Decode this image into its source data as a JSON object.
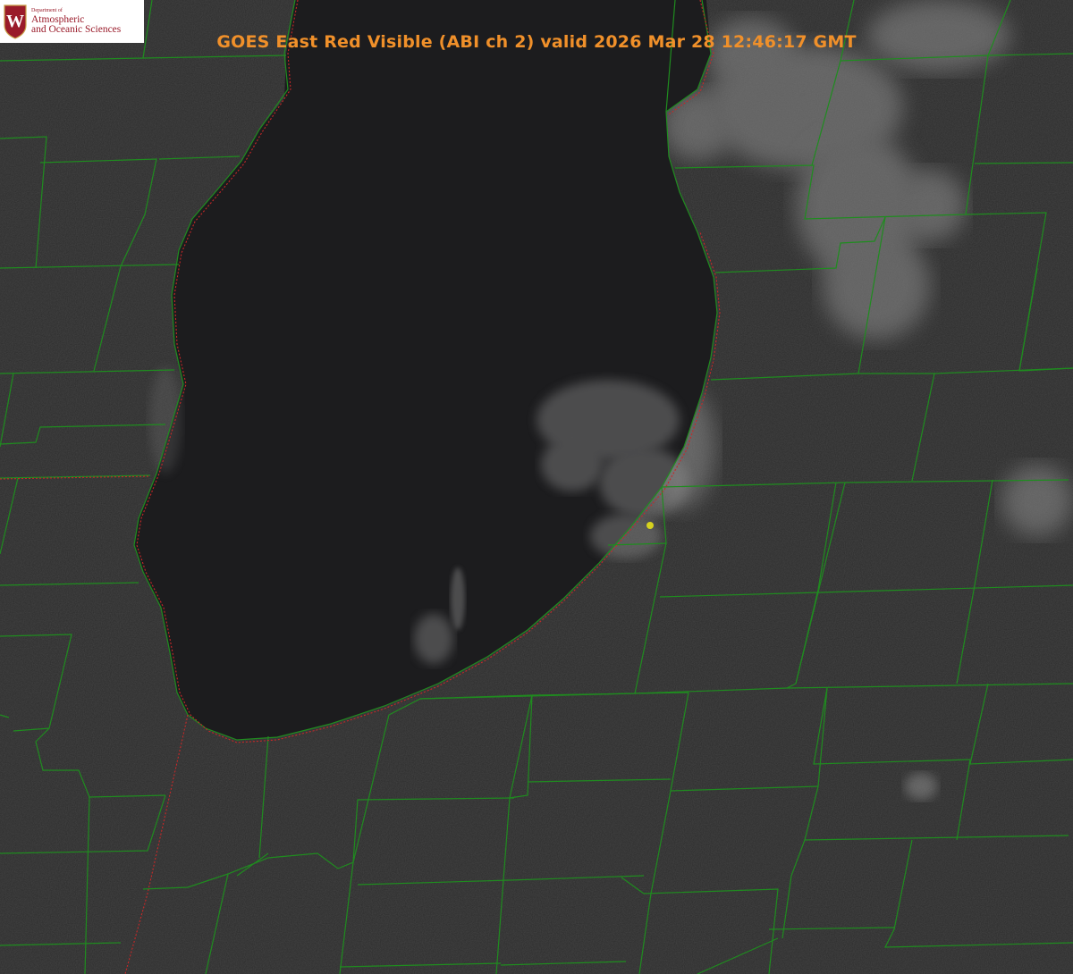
{
  "title": "GOES East Red Visible (ABI ch 2) valid 2026 Mar 28 12:46:17 GMT",
  "logo": {
    "letter": "W",
    "department": "Department of",
    "line1": "Atmospheric",
    "line2": "and Oceanic Sciences"
  },
  "colors": {
    "land": "#2b2b2b",
    "lake": "#1c1c1e",
    "county_lines": "#1f8c1f",
    "state_lines": "#c82828",
    "title_text": "#f0902a",
    "marker": "#d6d21e",
    "logo_red": "#9a1b2a",
    "cloud": "#9a9a9a"
  },
  "icons": {
    "marker": "location-marker-dot",
    "crest": "uw-crest-icon"
  }
}
